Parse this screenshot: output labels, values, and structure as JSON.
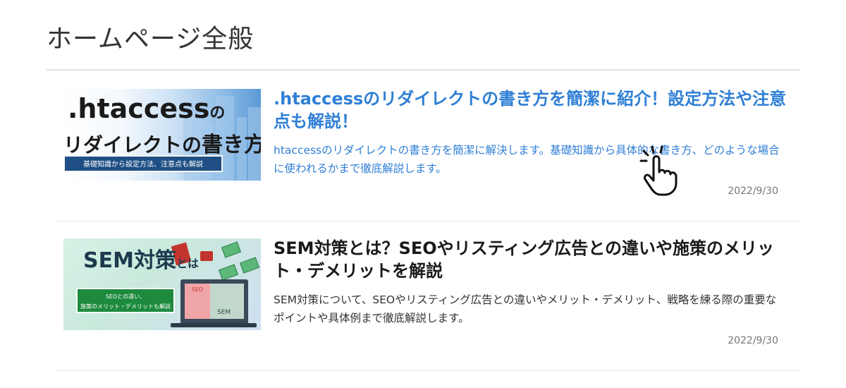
{
  "page": {
    "title": "ホームページ全般"
  },
  "articles": [
    {
      "title": ".htaccessのリダイレクトの書き方を簡潔に紹介！設定方法や注意点も解説！",
      "excerpt": "htaccessのリダイレクトの書き方を簡潔に解決します。基礎知識から具体的な書き方、どのような場合に使われるかまで徹底解説します。",
      "date": "2022/9/30",
      "thumb": {
        "line1": ".htaccess",
        "line1_suffix": "の",
        "line2a": "リダイレクトの",
        "line2b": "書き方",
        "band": "基礎知識から設定方法、注意点も解説"
      }
    },
    {
      "title": "SEM対策とは？SEOやリスティング広告との違いや施策のメリット・デメリットを解説",
      "excerpt": "SEM対策について、SEOやリスティング広告との違いやメリット・デメリット、戦略を練る際の重要なポイントや具体例まで徹底解説します。",
      "date": "2022/9/30",
      "thumb": {
        "line1": "SEM対策",
        "line1_suffix": "とは",
        "band_line1": "SEOとの違い、",
        "band_line2": "施策のメリット・デメリットも解説",
        "seo": "SEO",
        "sem": "SEM"
      }
    }
  ],
  "colors": {
    "link": "#2f7fd6",
    "text": "#1a1a1a",
    "rule": "#e2e2e2"
  },
  "icons": {
    "cursor": "pointer-hand-icon"
  }
}
